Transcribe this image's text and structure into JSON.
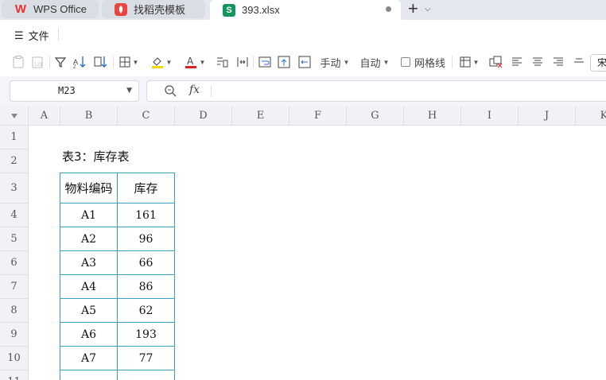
{
  "tabs": {
    "wps": "WPS Office",
    "daoke": "找稻壳模板",
    "file": "393.xlsx"
  },
  "menu": {
    "file_label": "文件"
  },
  "toolbar": {
    "row_height_mode": "手动",
    "col_width_mode": "自动",
    "gridlines_label": "网格线",
    "gridlines_checked": false,
    "font_preview": "宋"
  },
  "formula_bar": {
    "cell_ref": "M23",
    "fx_label": "fx",
    "formula_value": ""
  },
  "sheet": {
    "columns": [
      "A",
      "B",
      "C",
      "D",
      "E",
      "F",
      "G",
      "H",
      "I",
      "J",
      "K"
    ],
    "rows": [
      "1",
      "2",
      "3",
      "4",
      "5",
      "6",
      "7",
      "8",
      "9",
      "10",
      "11"
    ],
    "caption": "表3：库存表",
    "table_header": {
      "code": "物料编码",
      "stock": "库存"
    },
    "table_rows": [
      {
        "code": "A1",
        "stock": "161"
      },
      {
        "code": "A2",
        "stock": "96"
      },
      {
        "code": "A3",
        "stock": "66"
      },
      {
        "code": "A4",
        "stock": "86"
      },
      {
        "code": "A5",
        "stock": "62"
      },
      {
        "code": "A6",
        "stock": "193"
      },
      {
        "code": "A7",
        "stock": "77"
      }
    ]
  },
  "colors": {
    "accent_green": "#13955e",
    "table_border": "#3aa0c8",
    "highlight_yellow": "#f5d800",
    "font_red": "#e02020"
  }
}
